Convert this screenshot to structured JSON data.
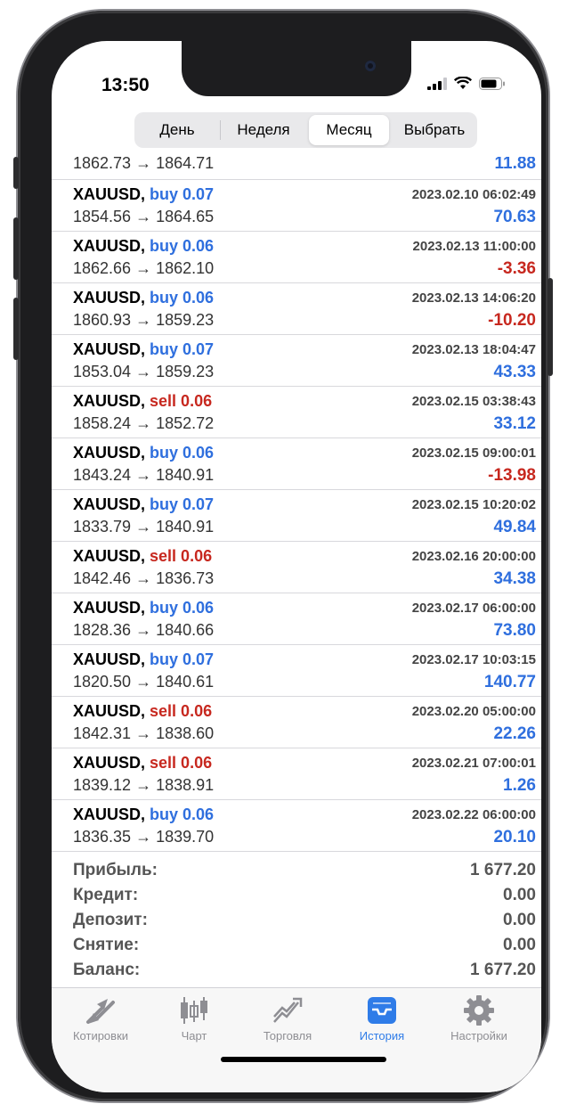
{
  "status": {
    "time": "13:50"
  },
  "period_tabs": [
    {
      "label": "День",
      "active": false
    },
    {
      "label": "Неделя",
      "active": false
    },
    {
      "label": "Месяц",
      "active": true
    },
    {
      "label": "Выбрать",
      "active": false
    }
  ],
  "partial_row": {
    "prices": "1862.73 → 1864.71",
    "profit": "11.88"
  },
  "deals": [
    {
      "symbol": "XAUUSD,",
      "side": "buy",
      "volume": "buy 0.07",
      "time": "2023.02.10 06:02:49",
      "prices": "1854.56 → 1864.65",
      "profit": "70.63",
      "sign": "pos"
    },
    {
      "symbol": "XAUUSD,",
      "side": "buy",
      "volume": "buy 0.06",
      "time": "2023.02.13 11:00:00",
      "prices": "1862.66 → 1862.10",
      "profit": "-3.36",
      "sign": "neg"
    },
    {
      "symbol": "XAUUSD,",
      "side": "buy",
      "volume": "buy 0.06",
      "time": "2023.02.13 14:06:20",
      "prices": "1860.93 → 1859.23",
      "profit": "-10.20",
      "sign": "neg"
    },
    {
      "symbol": "XAUUSD,",
      "side": "buy",
      "volume": "buy 0.07",
      "time": "2023.02.13 18:04:47",
      "prices": "1853.04 → 1859.23",
      "profit": "43.33",
      "sign": "pos"
    },
    {
      "symbol": "XAUUSD,",
      "side": "sell",
      "volume": "sell 0.06",
      "time": "2023.02.15 03:38:43",
      "prices": "1858.24 → 1852.72",
      "profit": "33.12",
      "sign": "pos"
    },
    {
      "symbol": "XAUUSD,",
      "side": "buy",
      "volume": "buy 0.06",
      "time": "2023.02.15 09:00:01",
      "prices": "1843.24 → 1840.91",
      "profit": "-13.98",
      "sign": "neg"
    },
    {
      "symbol": "XAUUSD,",
      "side": "buy",
      "volume": "buy 0.07",
      "time": "2023.02.15 10:20:02",
      "prices": "1833.79 → 1840.91",
      "profit": "49.84",
      "sign": "pos"
    },
    {
      "symbol": "XAUUSD,",
      "side": "sell",
      "volume": "sell 0.06",
      "time": "2023.02.16 20:00:00",
      "prices": "1842.46 → 1836.73",
      "profit": "34.38",
      "sign": "pos"
    },
    {
      "symbol": "XAUUSD,",
      "side": "buy",
      "volume": "buy 0.06",
      "time": "2023.02.17 06:00:00",
      "prices": "1828.36 → 1840.66",
      "profit": "73.80",
      "sign": "pos"
    },
    {
      "symbol": "XAUUSD,",
      "side": "buy",
      "volume": "buy 0.07",
      "time": "2023.02.17 10:03:15",
      "prices": "1820.50 → 1840.61",
      "profit": "140.77",
      "sign": "pos"
    },
    {
      "symbol": "XAUUSD,",
      "side": "sell",
      "volume": "sell 0.06",
      "time": "2023.02.20 05:00:00",
      "prices": "1842.31 → 1838.60",
      "profit": "22.26",
      "sign": "pos"
    },
    {
      "symbol": "XAUUSD,",
      "side": "sell",
      "volume": "sell 0.06",
      "time": "2023.02.21 07:00:01",
      "prices": "1839.12 → 1838.91",
      "profit": "1.26",
      "sign": "pos"
    },
    {
      "symbol": "XAUUSD,",
      "side": "buy",
      "volume": "buy 0.06",
      "time": "2023.02.22 06:00:00",
      "prices": "1836.35 → 1839.70",
      "profit": "20.10",
      "sign": "pos"
    }
  ],
  "summary": [
    {
      "label": "Прибыль:",
      "value": "1 677.20"
    },
    {
      "label": "Кредит:",
      "value": "0.00"
    },
    {
      "label": "Депозит:",
      "value": "0.00"
    },
    {
      "label": "Снятие:",
      "value": "0.00"
    },
    {
      "label": "Баланс:",
      "value": "1 677.20"
    }
  ],
  "tabbar": [
    {
      "label": "Котировки",
      "icon": "quotes-arrows-icon",
      "active": false
    },
    {
      "label": "Чарт",
      "icon": "candlestick-chart-icon",
      "active": false
    },
    {
      "label": "Торговля",
      "icon": "trade-trend-icon",
      "active": false
    },
    {
      "label": "История",
      "icon": "history-inbox-icon",
      "active": true
    },
    {
      "label": "Настройки",
      "icon": "settings-gear-icon",
      "active": false
    }
  ],
  "colors": {
    "buy": "#2f6fde",
    "sell": "#c7281f",
    "accent": "#2f7ce8",
    "inactive": "#8e8e93"
  }
}
